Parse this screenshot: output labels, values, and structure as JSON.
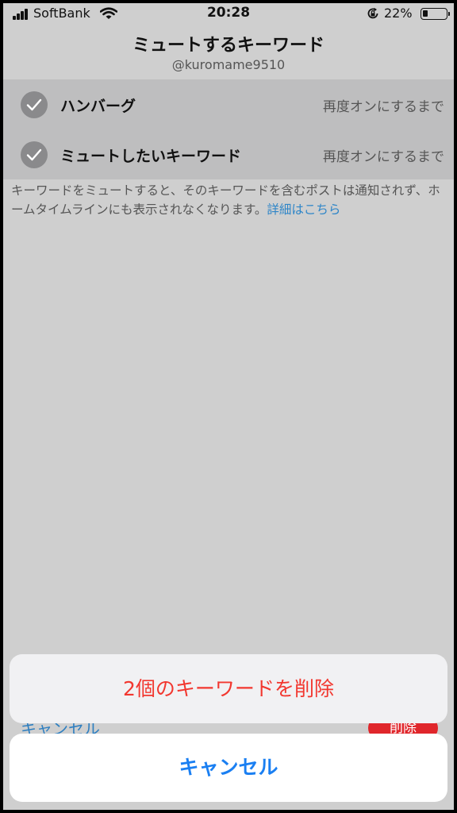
{
  "status_bar": {
    "carrier": "SoftBank",
    "time": "20:28",
    "battery_percent": "22%",
    "battery_level": 0.22,
    "icons": [
      "signal-icon",
      "wifi-icon",
      "rotation-lock-icon",
      "battery-icon"
    ]
  },
  "header": {
    "title": "ミュートするキーワード",
    "subtitle": "@kuromame9510"
  },
  "keywords": [
    {
      "label": "ハンバーグ",
      "duration": "再度オンにするまで",
      "checked": true
    },
    {
      "label": "ミュートしたいキーワード",
      "duration": "再度オンにするまで",
      "checked": true
    }
  ],
  "description": {
    "text": "キーワードをミュートすると、そのキーワードを含むポストは通知されず、ホームタイムラインにも表示されなくなります。",
    "link": "詳細はこちら"
  },
  "bottom_toolbar": {
    "cancel_label": "キャンセル",
    "delete_label": "削除"
  },
  "action_sheet": {
    "delete_label": "2個のキーワードを削除",
    "cancel_label": "キャンセル"
  },
  "colors": {
    "destructive": "#f2372f",
    "accent": "#1a7ff2",
    "overlay_bg": "#cfcfcf"
  }
}
